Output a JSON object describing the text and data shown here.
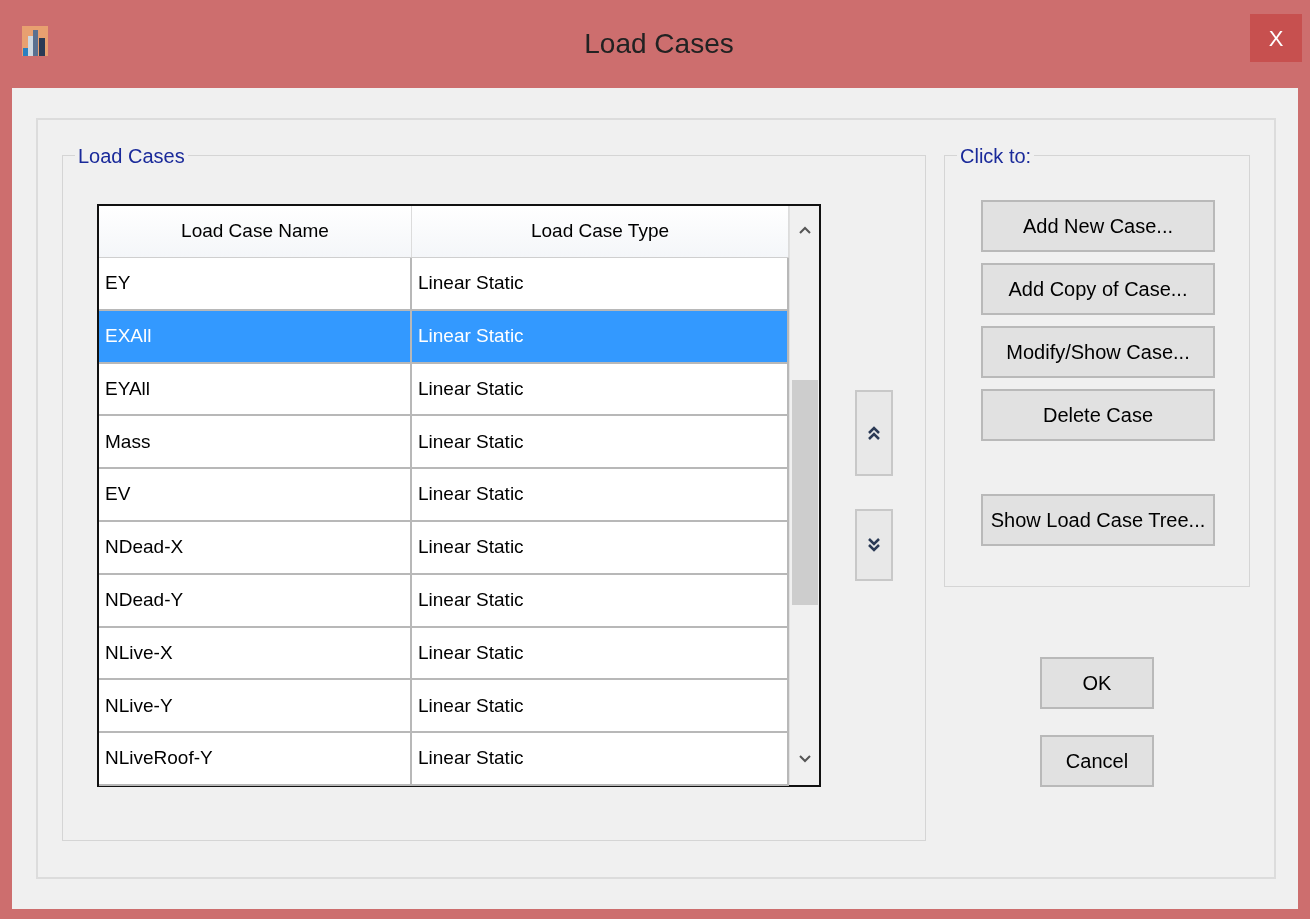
{
  "window": {
    "title": "Load Cases",
    "close": "X"
  },
  "load_cases": {
    "legend": "Load Cases",
    "columns": [
      "Load Case Name",
      "Load Case Type"
    ],
    "rows": [
      {
        "name": "EY",
        "type": "Linear Static",
        "selected": false
      },
      {
        "name": "EXAll",
        "type": "Linear Static",
        "selected": true
      },
      {
        "name": "EYAll",
        "type": "Linear Static",
        "selected": false
      },
      {
        "name": "Mass",
        "type": "Linear Static",
        "selected": false
      },
      {
        "name": "EV",
        "type": "Linear Static",
        "selected": false
      },
      {
        "name": "NDead-X",
        "type": "Linear Static",
        "selected": false
      },
      {
        "name": "NDead-Y",
        "type": "Linear Static",
        "selected": false
      },
      {
        "name": "NLive-X",
        "type": "Linear Static",
        "selected": false
      },
      {
        "name": "NLive-Y",
        "type": "Linear Static",
        "selected": false
      },
      {
        "name": "NLiveRoof-Y",
        "type": "Linear Static",
        "selected": false
      }
    ]
  },
  "actions": {
    "legend": "Click to:",
    "buttons": [
      "Add New Case...",
      "Add Copy of Case...",
      "Modify/Show Case...",
      "Delete Case",
      "Show Load Case Tree..."
    ]
  },
  "dialog_buttons": [
    "OK",
    "Cancel"
  ]
}
